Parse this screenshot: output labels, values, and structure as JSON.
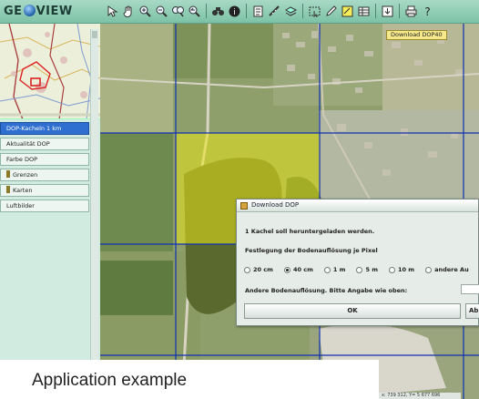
{
  "app": {
    "title_left": "GE",
    "title_right": "VIEW"
  },
  "toolbar": {
    "tools": [
      "select-icon",
      "pan-icon",
      "zoom-in-icon",
      "zoom-out-icon",
      "zoom-extent-icon",
      "zoom-previous-icon",
      "binoculars-icon",
      "info-icon",
      "legend-icon",
      "measure-icon",
      "layers-icon",
      "selection-icon",
      "edit-icon",
      "highlight-icon",
      "table-icon",
      "download-icon",
      "print-icon",
      "help-icon"
    ]
  },
  "sidebar": {
    "items": [
      {
        "label": "DOP-Kacheln 1 km",
        "active": true,
        "marker": false
      },
      {
        "label": "Aktualität DOP",
        "active": false,
        "marker": false
      },
      {
        "label": "Farbe DOP",
        "active": false,
        "marker": false
      },
      {
        "label": "Grenzen",
        "active": false,
        "marker": true
      },
      {
        "label": "Karten",
        "active": false,
        "marker": true
      },
      {
        "label": "Luftbilder",
        "active": false,
        "marker": false
      }
    ]
  },
  "map": {
    "badge": "Download DOP40",
    "highlight_color": "#e9e31a",
    "grid_color": "#1030b0"
  },
  "dialog": {
    "title": "Download DOP",
    "message": "1 Kachel soll heruntergeladen werden.",
    "resolution_heading": "Festlegung der Bodenauflösung je Pixel",
    "options": [
      {
        "label": "20 cm",
        "selected": false
      },
      {
        "label": "40 cm",
        "selected": true
      },
      {
        "label": "1 m",
        "selected": false
      },
      {
        "label": "5 m",
        "selected": false
      },
      {
        "label": "10 m",
        "selected": false
      },
      {
        "label": "andere Au",
        "selected": false
      }
    ],
    "other_prompt": "Andere Bodenauflösung. Bitte Angabe wie oben:",
    "ok_label": "OK",
    "cancel_label": "Ab"
  },
  "status": {
    "coords": "x: 739 312, Y= 5 677 696"
  },
  "caption": {
    "text": "Application example"
  }
}
